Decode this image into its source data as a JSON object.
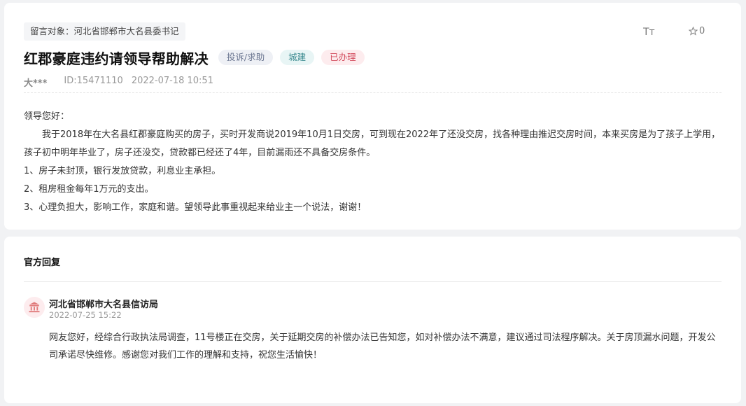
{
  "message": {
    "target_label": "留言对象：河北省邯郸市大名县委书记",
    "title": "红郡豪庭违约请领导帮助解决",
    "tags": {
      "type": "投诉/求助",
      "category": "城建",
      "status": "已办理"
    },
    "font_size_button": "Tт",
    "star_count": "0",
    "author": "大***",
    "id": "ID:15471110",
    "time": "2022-07-18 10:51",
    "content": [
      "领导您好：",
      "我于2018年在大名县红郡豪庭购买的房子，买时开发商说2019年10月1日交房，可到现在2022年了还没交房，找各种理由推迟交房时间，本来买房是为了孩子上学用，孩子初中明年毕业了，房子还没交，贷款都已经还了4年，目前漏雨还不具备交房条件。",
      "1、房子未封顶，银行发放贷款，利息业主承担。",
      "2、租房租金每年1万元的支出。",
      "3、心理负担大，影响工作，家庭和谐。望领导此事重视起来给业主一个说法，谢谢！"
    ]
  },
  "reply": {
    "section_title": "官方回复",
    "org_icon": "government-building-icon",
    "org_name": "河北省邯郸市大名县信访局",
    "time": "2022-07-25 15:22",
    "body": "网友您好，经综合行政执法局调查，11号楼正在交房，关于延期交房的补偿办法已告知您，如对补偿办法不满意，建议通过司法程序解决。关于房顶漏水问题，开发公司承诺尽快维修。感谢您对我们工作的理解和支持，祝您生活愉快！"
  },
  "colors": {
    "page_bg": "#f1f2f4",
    "tag_status": "#d24a5c",
    "tag_category": "#3a8a8f",
    "tag_type": "#6a7590",
    "org_icon": "#e07a7a"
  }
}
